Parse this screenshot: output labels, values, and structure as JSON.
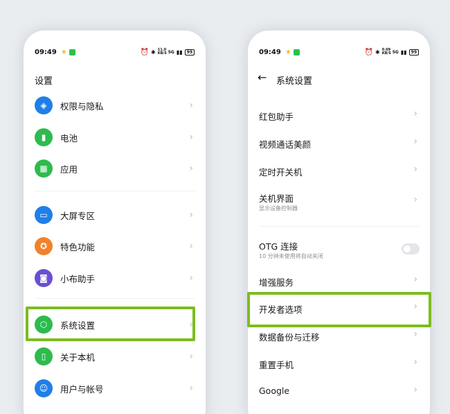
{
  "left": {
    "status": {
      "time": "09:49",
      "network": "11.0 KB/S",
      "signal": "5G",
      "battery": "99"
    },
    "title": "设置",
    "items": [
      {
        "label": "权限与隐私",
        "icon": "privacy-icon",
        "color": "#1f7fe8"
      },
      {
        "label": "电池",
        "icon": "battery-icon",
        "color": "#2dbb4e"
      },
      {
        "label": "应用",
        "icon": "apps-grid-icon",
        "color": "#2dbb4e"
      },
      {
        "label": "大屏专区",
        "icon": "large-screen-icon",
        "color": "#1f7fe8"
      },
      {
        "label": "特色功能",
        "icon": "star-feature-icon",
        "color": "#f2822a"
      },
      {
        "label": "小布助手",
        "icon": "assistant-icon",
        "color": "#6a4fd4"
      },
      {
        "label": "系统设置",
        "icon": "system-settings-icon",
        "color": "#2dbb4e"
      },
      {
        "label": "关于本机",
        "icon": "phone-icon",
        "color": "#2dbb4e"
      },
      {
        "label": "用户与帐号",
        "icon": "user-account-icon",
        "color": "#1f7fe8"
      }
    ]
  },
  "right": {
    "status": {
      "time": "09:49",
      "network": "0.09 KB/S",
      "signal": "5G",
      "battery": "99"
    },
    "title": "系统设置",
    "items": [
      {
        "label": "红包助手"
      },
      {
        "label": "视频通话美颜"
      },
      {
        "label": "定时开关机"
      },
      {
        "label": "关机界面",
        "sub": "显示设备控制器"
      },
      {
        "label": "OTG 连接",
        "sub": "10 分钟未使用将自动关闭"
      },
      {
        "label": "增强服务"
      },
      {
        "label": "开发者选项"
      },
      {
        "label": "数据备份与迁移"
      },
      {
        "label": "重置手机"
      },
      {
        "label": "Google"
      }
    ]
  },
  "colors": {
    "highlight": "#7cbd1e",
    "background": "#eaedf0"
  }
}
